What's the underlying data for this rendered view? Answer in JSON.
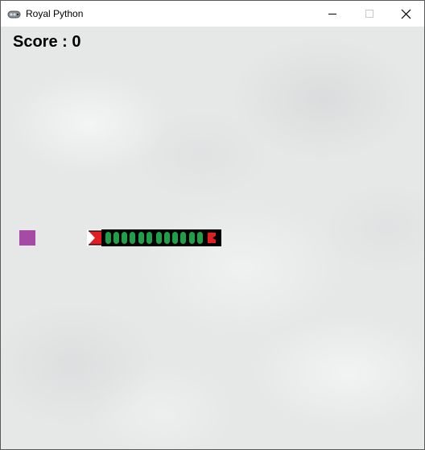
{
  "window": {
    "title": "Royal Python",
    "app_icon": "python-icon",
    "controls": [
      "minimize-icon",
      "maximize-icon",
      "close-icon"
    ]
  },
  "game": {
    "score_label": "Score : 0",
    "score": 0,
    "food": {
      "color": "#a54aa5"
    },
    "snake": {
      "head_color": "#e21e24",
      "tail_color": "#e21e24",
      "segment_color": "#1f9f47",
      "segment_outline": "#000000",
      "body_segments": 9,
      "direction": "left"
    },
    "background": "stone-texture",
    "background_color": "#e6e7e7"
  }
}
